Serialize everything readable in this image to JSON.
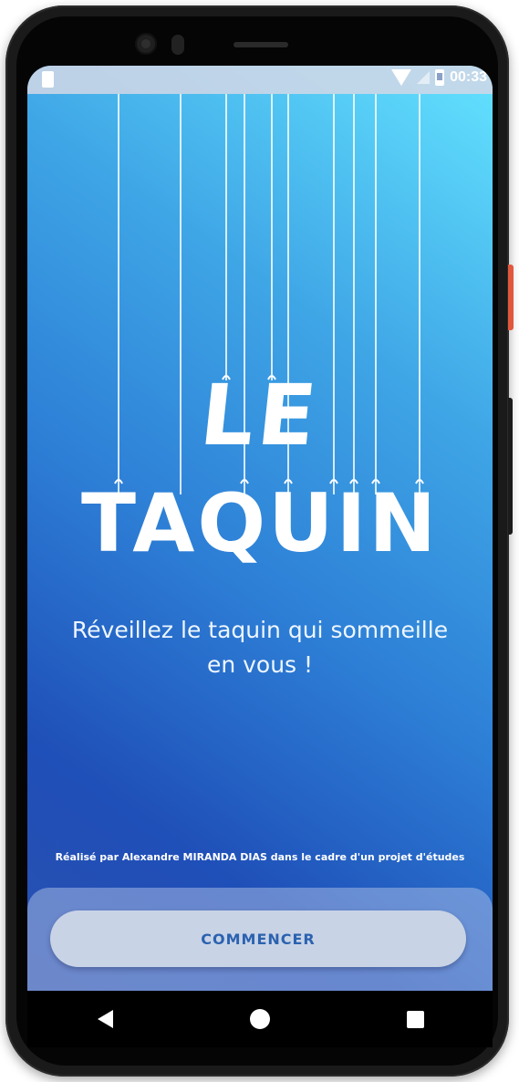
{
  "status_bar": {
    "time": "00:33",
    "icons": [
      "notification-icon",
      "wifi-icon",
      "signal-icon",
      "battery-charging-icon"
    ]
  },
  "logo": {
    "line1": "LE",
    "line2": "TAQUIN"
  },
  "tagline": "Réveillez le taquin qui sommeille en vous !",
  "credit": "Réalisé par Alexandre MIRANDA DIAS dans le cadre d'un projet d'études",
  "start_button": {
    "label": "COMMENCER"
  },
  "nav_bar": {
    "icons": [
      "back-icon",
      "home-icon",
      "recents-icon"
    ]
  },
  "colors": {
    "gradient_top": "#63e3ff",
    "gradient_bottom": "#1f4fb8",
    "button_text": "#2b62b0",
    "side_button_accent": "#e2583e"
  }
}
